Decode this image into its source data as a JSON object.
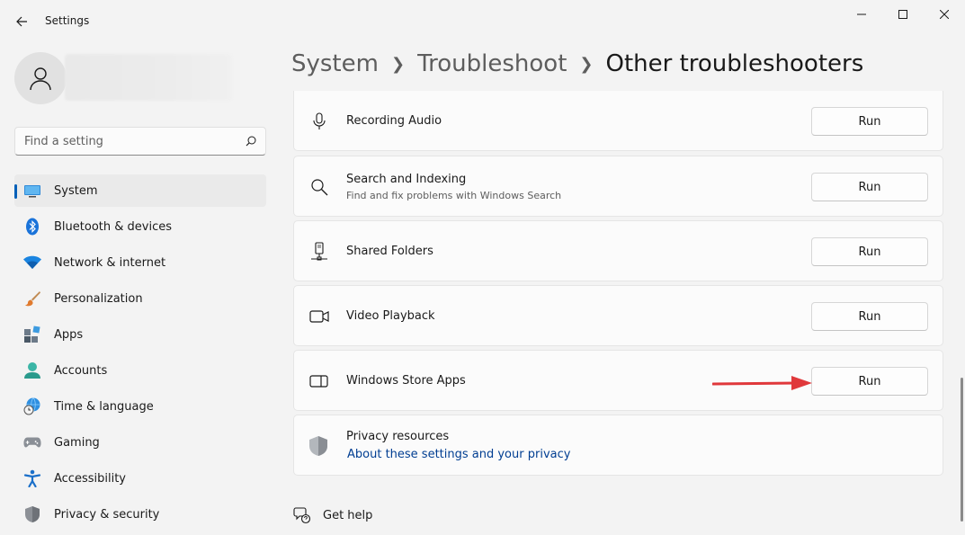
{
  "window": {
    "title": "Settings"
  },
  "search": {
    "placeholder": "Find a setting"
  },
  "sidebar": {
    "items": [
      {
        "label": "System",
        "icon": "monitor-icon",
        "active": true
      },
      {
        "label": "Bluetooth & devices",
        "icon": "bluetooth-icon"
      },
      {
        "label": "Network & internet",
        "icon": "wifi-icon"
      },
      {
        "label": "Personalization",
        "icon": "brush-icon"
      },
      {
        "label": "Apps",
        "icon": "apps-icon"
      },
      {
        "label": "Accounts",
        "icon": "person-icon"
      },
      {
        "label": "Time & language",
        "icon": "globe-clock-icon"
      },
      {
        "label": "Gaming",
        "icon": "gamepad-icon"
      },
      {
        "label": "Accessibility",
        "icon": "accessibility-icon"
      },
      {
        "label": "Privacy & security",
        "icon": "shield-icon"
      }
    ]
  },
  "breadcrumb": {
    "items": [
      "System",
      "Troubleshoot"
    ],
    "current": "Other troubleshooters"
  },
  "troubleshooters": [
    {
      "title": "Recording Audio",
      "subtitle": "",
      "button": "Run",
      "icon": "microphone-icon"
    },
    {
      "title": "Search and Indexing",
      "subtitle": "Find and fix problems with Windows Search",
      "button": "Run",
      "icon": "search-icon"
    },
    {
      "title": "Shared Folders",
      "subtitle": "",
      "button": "Run",
      "icon": "network-folder-icon"
    },
    {
      "title": "Video Playback",
      "subtitle": "",
      "button": "Run",
      "icon": "video-camera-icon"
    },
    {
      "title": "Windows Store Apps",
      "subtitle": "",
      "button": "Run",
      "icon": "store-app-icon"
    }
  ],
  "privacy": {
    "title": "Privacy resources",
    "link": "About these settings and your privacy",
    "icon": "shield-icon"
  },
  "help": {
    "label": "Get help",
    "icon": "help-chat-icon"
  },
  "colors": {
    "accent": "#005fb8",
    "annotation_arrow": "#e0383b",
    "link": "#003e92"
  }
}
